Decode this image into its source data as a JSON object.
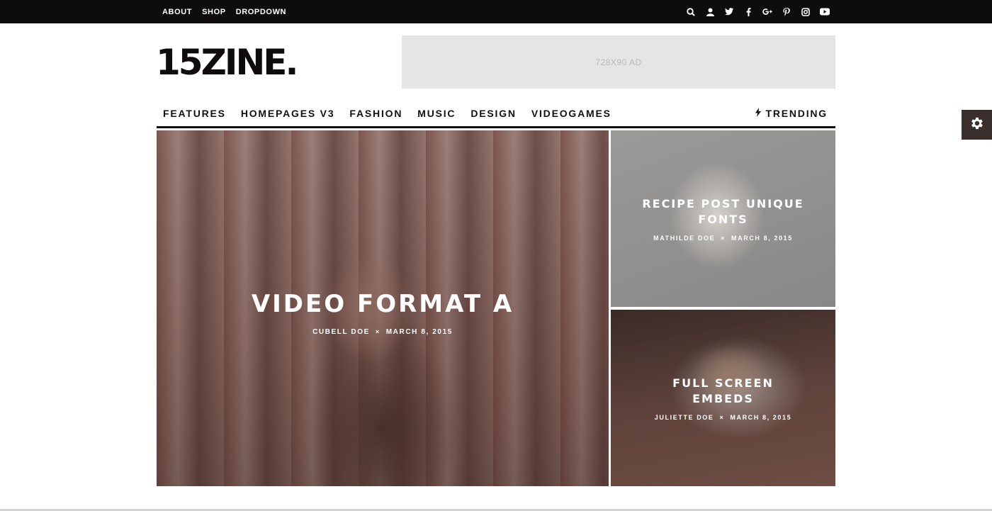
{
  "topbar": {
    "links": [
      "ABOUT",
      "SHOP",
      "DROPDOWN"
    ],
    "icons": [
      "search-icon",
      "user-icon",
      "twitter-icon",
      "facebook-icon",
      "google-plus-icon",
      "pinterest-icon",
      "instagram-icon",
      "youtube-icon"
    ]
  },
  "header": {
    "logo": "15ZINE.",
    "ad_label": "728X90 AD"
  },
  "nav": {
    "items": [
      "FEATURES",
      "HOMEPAGES V3",
      "FASHION",
      "MUSIC",
      "DESIGN",
      "VIDEOGAMES"
    ],
    "trending": "TRENDING"
  },
  "tiles": {
    "big": {
      "title": "VIDEO FORMAT A",
      "author": "CUBELL DOE",
      "separator": "×",
      "date": "MARCH 8, 2015"
    },
    "top": {
      "title": "RECIPE POST UNIQUE FONTS",
      "author": "MATHILDE DOE",
      "separator": "×",
      "date": "MARCH 8, 2015"
    },
    "bottom": {
      "title": "FULL SCREEN EMBEDS",
      "author": "JULIETTE DOE",
      "separator": "×",
      "date": "MARCH 8, 2015"
    }
  },
  "colors": {
    "topbar_bg": "#0e0c0d",
    "gear_bg": "#3a2f2c",
    "ad_bg": "#e5e5e5"
  }
}
